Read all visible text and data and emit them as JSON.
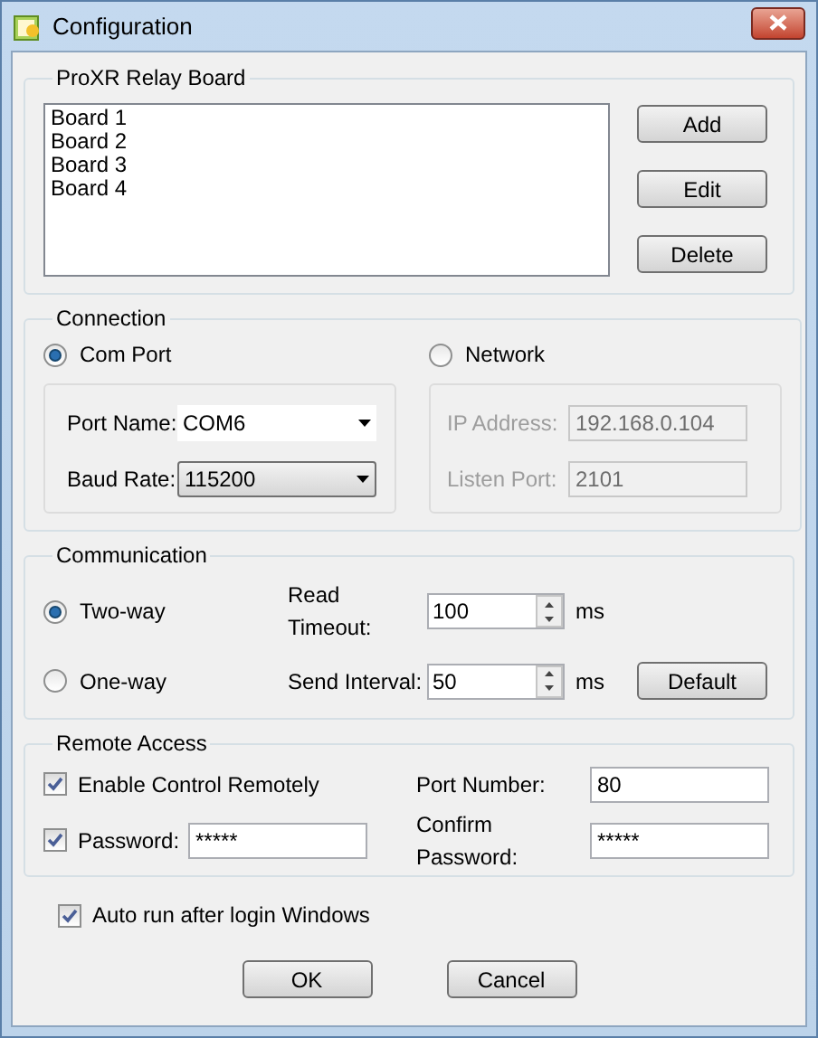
{
  "window": {
    "title": "Configuration"
  },
  "board_group": {
    "title": "ProXR Relay Board",
    "boards": [
      {
        "label": "Board 1",
        "selected": false
      },
      {
        "label": "Board 2",
        "selected": false
      },
      {
        "label": "Board 3",
        "selected": false
      },
      {
        "label": "Board 4",
        "selected": false
      }
    ],
    "buttons": [
      "Add",
      "Edit",
      "Delete"
    ]
  },
  "connection": {
    "title": "Connection",
    "options": [
      {
        "label": "Com Port",
        "selected": true
      },
      {
        "label": "Network",
        "selected": false
      }
    ],
    "com_fields": [
      {
        "label": "Port Name:",
        "value": "COM6",
        "kind": "dropdown"
      },
      {
        "label": "Baud Rate:",
        "value": "115200",
        "kind": "combo"
      }
    ],
    "network_disabled": true,
    "network_fields": [
      {
        "label": "IP Address:",
        "value": "192.168.0.104"
      },
      {
        "label": "Listen Port:",
        "value": "2101"
      }
    ]
  },
  "communication": {
    "title": "Communication",
    "modes": [
      {
        "label": "Two-way",
        "selected": true
      },
      {
        "label": "One-way",
        "selected": false
      }
    ],
    "fields": [
      {
        "label": "Read Timeout:",
        "value": "100",
        "unit": "ms"
      },
      {
        "label": "Send Interval:",
        "value": "50",
        "unit": "ms"
      }
    ],
    "default_button": "Default"
  },
  "remote_access": {
    "title": "Remote Access",
    "enable": {
      "label": "Enable Control Remotely",
      "checked": true
    },
    "password": {
      "label": "Password:",
      "checked": true,
      "value": "*****"
    },
    "port_number": {
      "label": "Port Number:",
      "value": "80"
    },
    "confirm_password": {
      "label": "Confirm Password:",
      "value": "*****"
    }
  },
  "autorun": {
    "label": "Auto run after login Windows",
    "checked": true
  },
  "buttons": [
    "OK",
    "Cancel"
  ]
}
